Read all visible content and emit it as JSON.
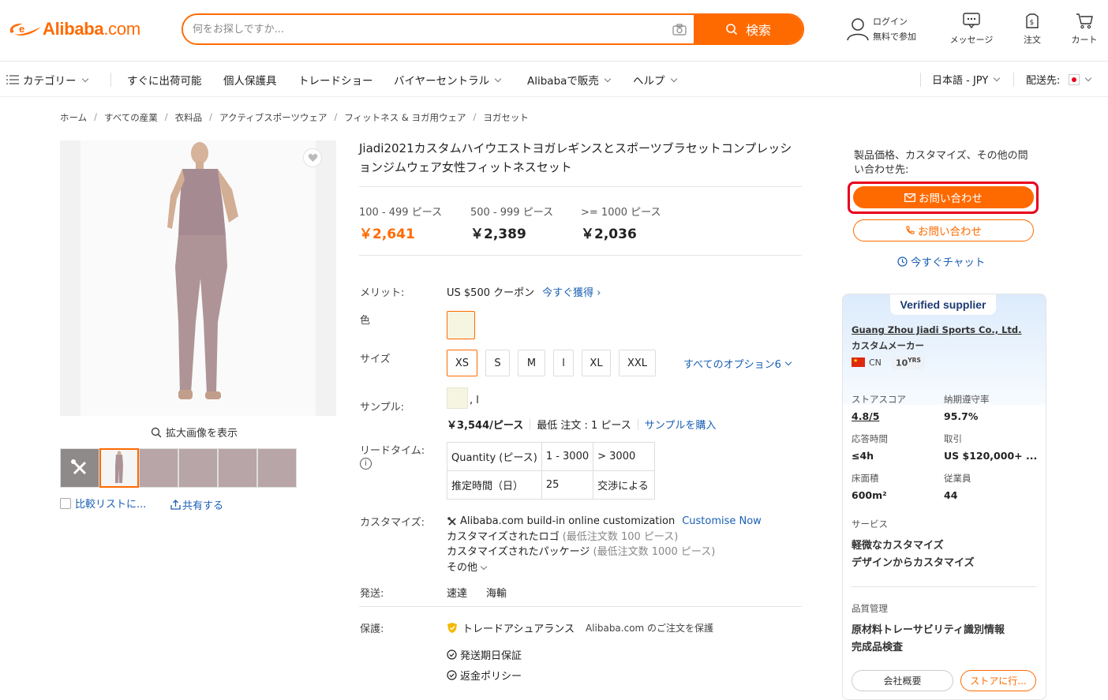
{
  "header": {
    "logo": {
      "brand": "Alibaba",
      "domain": ".com"
    },
    "search": {
      "placeholder": "何をお探しですか...",
      "button": "検索"
    },
    "signin": {
      "line1": "ログイン",
      "line2": "無料で参加"
    },
    "messages": "メッセージ",
    "orders": "注文",
    "cart": "カート"
  },
  "nav": {
    "categories": "カテゴリー",
    "items": [
      "すぐに出荷可能",
      "個人保護具",
      "トレードショー",
      "バイヤーセントラル",
      "Alibabaで販売",
      "ヘルプ"
    ],
    "language": "日本語 - JPY",
    "ship_to": "配送先:"
  },
  "breadcrumb": [
    "ホーム",
    "すべての産業",
    "衣料品",
    "アクティブスポーツウェア",
    "フィットネス & ヨガ用ウェア",
    "ヨガセット"
  ],
  "gallery": {
    "view_larger": "拡大画像を表示",
    "compare": "比較リストに...",
    "share": "共有する"
  },
  "product": {
    "title": "Jiadi2021カスタムハイウエストヨガレギンスとスポーツブラセットコンプレッションジムウェア女性フィットネスセット",
    "price_tiers": [
      {
        "qty": "100 - 499 ピース",
        "price": "￥2,641"
      },
      {
        "qty": "500 - 999 ピース",
        "price": "￥2,389"
      },
      {
        "qty": ">= 1000 ピース",
        "price": "￥2,036"
      }
    ],
    "merit": {
      "label": "メリット:",
      "coupon": "US $500 クーポン",
      "link": "今すぐ獲得"
    },
    "color_label": "色",
    "size": {
      "label": "サイズ",
      "options": [
        "XS",
        "S",
        "M",
        "l",
        "XL",
        "XXL"
      ],
      "selected": "XS",
      "all_options": "すべてのオプション6"
    },
    "sample": {
      "label": "サンプル:",
      "suffix": ", l",
      "price": "￥3,544/ピース",
      "moq": "最低 注文 : 1 ピース",
      "buy": "サンプルを購入"
    },
    "lead_time": {
      "label": "リードタイム:",
      "row1": [
        "Quantity (ピース)",
        "1 - 3000",
        "> 3000"
      ],
      "row2": [
        "推定時間（日）",
        "25",
        "交渉による"
      ]
    },
    "customize": {
      "label": "カスタマイズ:",
      "line1": "Alibaba.com build-in online customization",
      "line1_link": "Customise Now",
      "logo": "カスタマイズされたロゴ",
      "logo_moq": "(最低注文数 100 ピース)",
      "pkg": "カスタマイズされたパッケージ",
      "pkg_moq": "(最低注文数 1000 ピース)",
      "more": "その他"
    },
    "shipping": {
      "label": "発送:",
      "options": [
        "速達",
        "海輸"
      ]
    },
    "protection": {
      "label": "保護:",
      "ta": "トレードアシュアランス",
      "ta_note": "Alibaba.com のご注文を保護",
      "items": [
        "発送期日保証",
        "返金ポリシー"
      ]
    }
  },
  "contact": {
    "prompt": "製品価格、カスタマイズ、その他の問い合わせ先:",
    "inquiry": "お問い合わせ",
    "call": "お問い合わせ",
    "chat": "今すぐチャット"
  },
  "supplier": {
    "badge": "Verified supplier",
    "name": "Guang Zhou Jiadi Sports Co., Ltd.",
    "type": "カスタムメーカー",
    "country": "CN",
    "years": "10",
    "years_unit": "YRS",
    "stats": [
      {
        "label": "ストアスコア",
        "value": "4.8/5"
      },
      {
        "label": "納期遵守率",
        "value": "95.7%"
      },
      {
        "label": "応答時間",
        "value": "≤4h"
      },
      {
        "label": "取引",
        "value": "US $120,000+ ..."
      },
      {
        "label": "床面積",
        "value": "600m²"
      },
      {
        "label": "従業員",
        "value": "44"
      }
    ],
    "services_label": "サービス",
    "services": [
      "軽微なカスタマイズ",
      "デザインからカスタマイズ"
    ],
    "qc_label": "品質管理",
    "qc": [
      "原材料トレーサビリティ識別情報",
      "完成品検査"
    ],
    "profile_btn": "会社概要",
    "store_btn": "ストアに行..."
  },
  "colors": {
    "accent": "#ff6a00",
    "link": "#1a5fb4",
    "highlight": "#e8001c"
  }
}
